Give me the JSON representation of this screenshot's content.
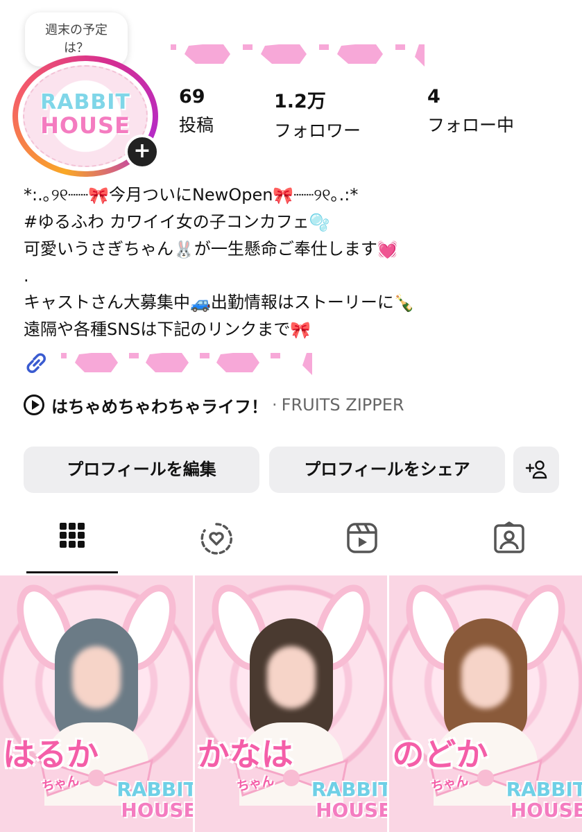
{
  "note": {
    "text_line1": "週末の予定",
    "text_line2": "は？"
  },
  "avatar": {
    "logo_line1": "RABBIT",
    "logo_line2": "HOUSE",
    "add_icon": "plus-icon"
  },
  "stats": [
    {
      "value": "69",
      "label": "投稿"
    },
    {
      "value": "1.2万",
      "label": "フォロワー"
    },
    {
      "value": "4",
      "label": "フォロー中"
    }
  ],
  "bio": {
    "line1_a": "*:.｡୨୧┈┈",
    "line1_b": "今月ついにNewOpen",
    "line1_c": "┈┈୨୧｡.:*",
    "line2_a": "#ゆるふわ カワイイ女の子コンカフェ",
    "line3_a": "可愛いうさぎちゃん",
    "line3_b": "が一生懸命ご奉仕します",
    "line4": ".",
    "line5_a": "キャストさん大募集中",
    "line5_b": "出勤情報はストーリーに",
    "line6_a": "遠隔や各種SNSは下記のリンクまで",
    "emoji_ribbon": "🎀",
    "emoji_bubbles": "🫧",
    "emoji_rabbit": "🐰",
    "emoji_heart": "💓",
    "emoji_car": "🚙",
    "emoji_bottle": "🍾"
  },
  "music": {
    "title": "はちゃめちゃわちゃライフ！",
    "separator": "·",
    "artist": "FRUITS ZIPPER"
  },
  "buttons": {
    "edit": "プロフィールを編集",
    "share": "プロフィールをシェア",
    "add_person_icon": "add-person-icon"
  },
  "tabs": [
    {
      "icon": "grid-icon",
      "active": true
    },
    {
      "icon": "reposts-icon",
      "active": false
    },
    {
      "icon": "reels-icon",
      "active": false
    },
    {
      "icon": "tagged-icon",
      "active": false
    }
  ],
  "posts": [
    {
      "name": "はるか",
      "suffix": "ちゃん",
      "logo1": "RABBIT",
      "logo2": "HOUSE",
      "hair_color": "#6b7b86"
    },
    {
      "name": "かなは",
      "suffix": "ちゃん",
      "logo1": "RABBIT",
      "logo2": "HOUSE",
      "hair_color": "#4a3a30"
    },
    {
      "name": "のどか",
      "suffix": "ちゃん",
      "logo1": "RABBIT",
      "logo2": "HOUSE",
      "hair_color": "#8a5a3a"
    }
  ],
  "colors": {
    "pink_deco": "#f7a8d8",
    "link_blue": "#3a5bd0",
    "tab_active": "#111111",
    "tab_inactive": "#555555"
  }
}
